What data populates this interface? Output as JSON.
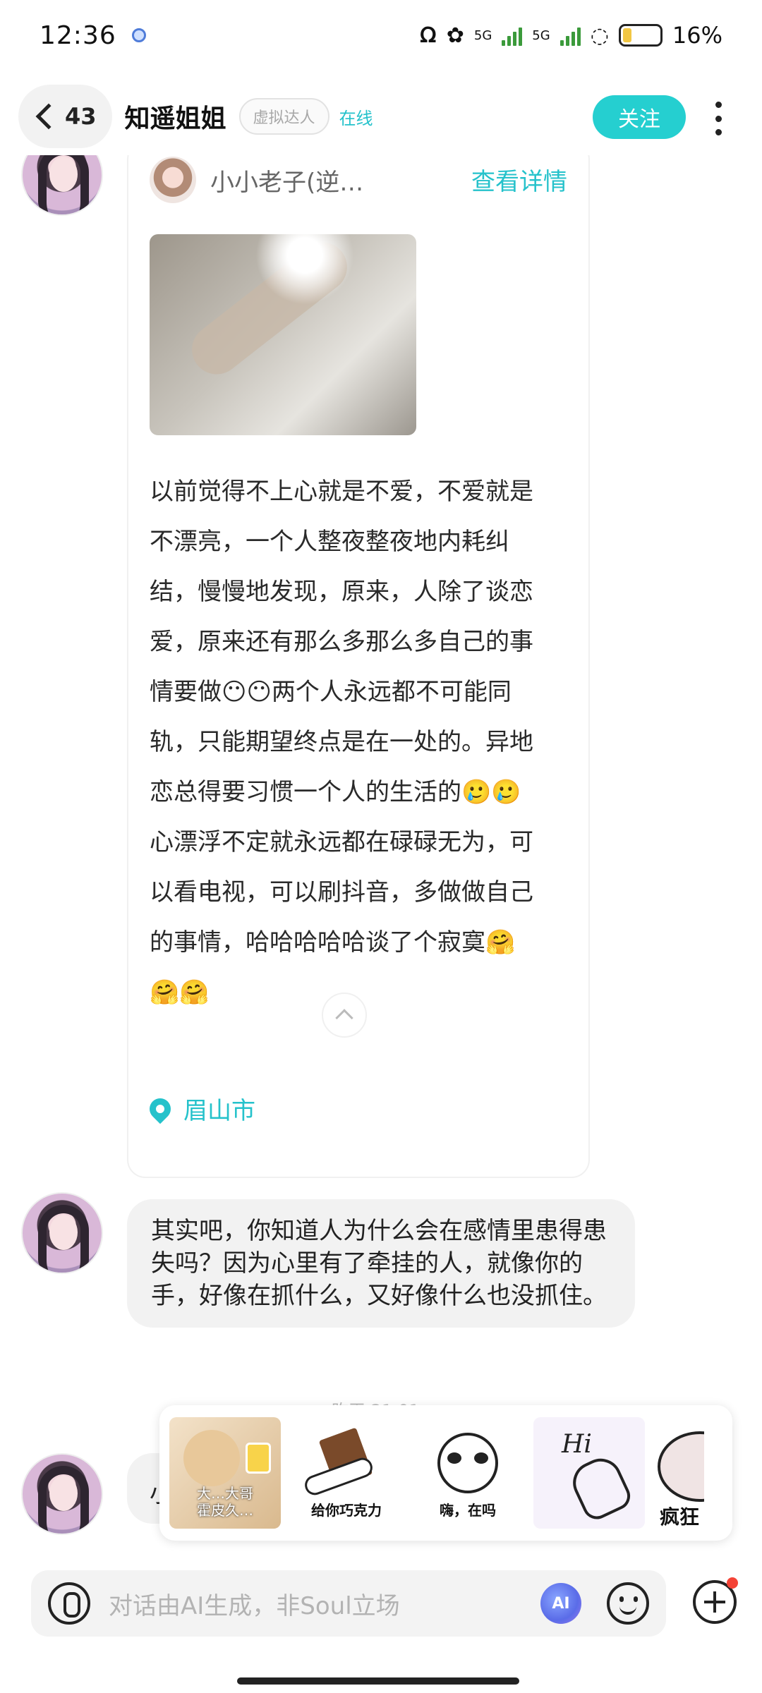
{
  "status_bar": {
    "time": "12:36",
    "battery_text": "16%",
    "network_label_1": "5G",
    "network_label_2": "5G"
  },
  "header": {
    "back_count": "43",
    "name": "知遥姐姐",
    "virtual_tag": "虚拟达人",
    "online_status": "在线",
    "follow_label": "关注"
  },
  "post_card": {
    "author_name": "小小老子(逆…",
    "view_detail_label": "查看详情",
    "text": "以前觉得不上心就是不爱，不爱就是不漂亮，一个人整夜整夜地内耗纠结，慢慢地发现，原来，人除了谈恋爱，原来还有那么多那么多自己的事情要做😶😶两个人永远都不可能同轨，只能期望终点是在一处的。异地恋总得要习惯一个人的生活的🥲🥲心漂浮不定就永远都在碌碌无为，可以看电视，可以刷抖音，多做做自己的事情，哈哈哈哈哈谈了个寂寞🤗🤗🤗",
    "location": "眉山市"
  },
  "messages": [
    {
      "text": "其实吧，你知道人为什么会在感情里患得患失吗？因为心里有了牵挂的人，就像你的手，好像在抓什么，又好像什么也没抓住。"
    }
  ],
  "timestamp": "昨天 21:01",
  "partial_message": "小",
  "stickers": [
    {
      "label": "大…大哥\n霍皮久…"
    },
    {
      "label": "给你巧克力"
    },
    {
      "label": "嗨，在吗"
    },
    {
      "label": "Hi"
    },
    {
      "label": "疯狂"
    }
  ],
  "input": {
    "placeholder": "对话由AI生成，非Soul立场",
    "ai_label": "AI"
  },
  "colors": {
    "accent": "#25cfd0",
    "notification": "#f44336"
  }
}
